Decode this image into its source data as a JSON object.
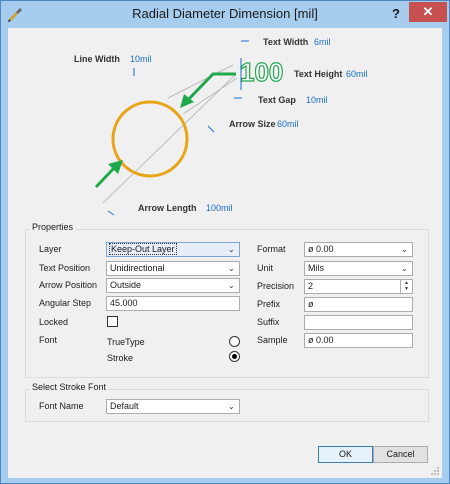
{
  "window": {
    "title": "Radial Diameter Dimension [mil]",
    "help_label": "?",
    "close_label": "✕"
  },
  "preview": {
    "line_width": {
      "label": "Line Width",
      "value": "10mil"
    },
    "text_width": {
      "label": "Text Width",
      "value": "6mil"
    },
    "text_height": {
      "label": "Text Height",
      "value": "60mil"
    },
    "text_gap": {
      "label": "Text Gap",
      "value": "10mil"
    },
    "arrow_size": {
      "label": "Arrow Size",
      "value": "60mil"
    },
    "arrow_length": {
      "label": "Arrow Length",
      "value": "100mil"
    },
    "sample_text": "100",
    "colors": {
      "circle": "#e8a317",
      "arrow": "#1fa84c",
      "dim_text": "#1fa84c",
      "value_text": "#1a6ed0"
    }
  },
  "properties": {
    "title": "Properties",
    "layer": {
      "label": "Layer",
      "value": "Keep-Out Layer"
    },
    "text_position": {
      "label": "Text Position",
      "value": "Unidirectional"
    },
    "arrow_position": {
      "label": "Arrow Position",
      "value": "Outside"
    },
    "angular_step": {
      "label": "Angular Step",
      "value": "45.000"
    },
    "locked": {
      "label": "Locked",
      "checked": false
    },
    "font": {
      "label": "Font",
      "options": [
        {
          "label": "TrueType",
          "selected": false
        },
        {
          "label": "Stroke",
          "selected": true
        }
      ]
    },
    "format": {
      "label": "Format",
      "value": "ø 0.00"
    },
    "unit": {
      "label": "Unit",
      "value": "Mils"
    },
    "precision": {
      "label": "Precision",
      "value": "2"
    },
    "prefix": {
      "label": "Prefix",
      "value": "ø"
    },
    "suffix": {
      "label": "Suffix",
      "value": ""
    },
    "sample": {
      "label": "Sample",
      "value": "ø 0.00"
    }
  },
  "stroke_font": {
    "title": "Select Stroke Font",
    "font_name": {
      "label": "Font Name",
      "value": "Default"
    }
  },
  "buttons": {
    "ok": "OK",
    "cancel": "Cancel"
  }
}
